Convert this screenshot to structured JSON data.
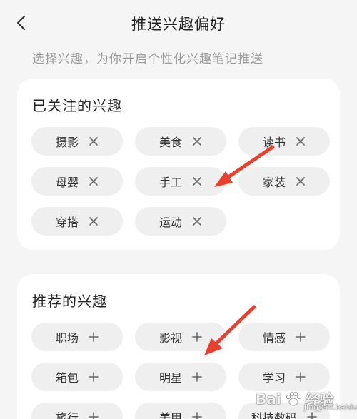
{
  "header": {
    "title": "推送兴趣偏好",
    "back_icon": "chevron-left-icon"
  },
  "subtitle": "选择兴趣，为你开启个性化兴趣笔记推送",
  "followed": {
    "title": "已关注的兴趣",
    "action_icon": "close-icon",
    "items": [
      {
        "label": "摄影"
      },
      {
        "label": "美食"
      },
      {
        "label": "读书"
      },
      {
        "label": "母婴"
      },
      {
        "label": "手工"
      },
      {
        "label": "家装"
      },
      {
        "label": "穿搭"
      },
      {
        "label": "运动"
      }
    ]
  },
  "recommended": {
    "title": "推荐的兴趣",
    "action_icon": "plus-icon",
    "items": [
      {
        "label": "职场"
      },
      {
        "label": "影视"
      },
      {
        "label": "情感"
      },
      {
        "label": "箱包"
      },
      {
        "label": "明星"
      },
      {
        "label": "学习"
      },
      {
        "label": "旅行"
      },
      {
        "label": "美甲"
      },
      {
        "label": "科技数码"
      }
    ]
  },
  "annotations": {
    "arrow_color": "#e8402f"
  },
  "watermark": {
    "brand": "Bai",
    "brand_suffix": "经验",
    "sub": "jingyan.baidu.com"
  }
}
